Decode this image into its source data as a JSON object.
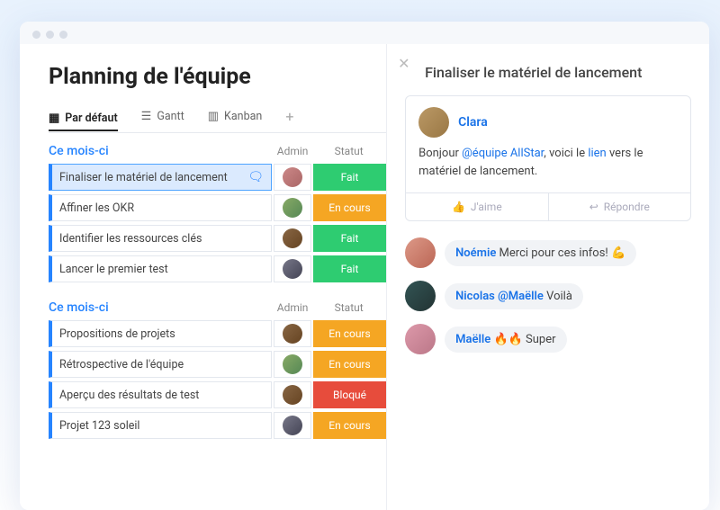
{
  "title": "Planning de l'équipe",
  "tabs": {
    "default": "Par défaut",
    "gantt": "Gantt",
    "kanban": "Kanban"
  },
  "cols": {
    "admin": "Admin",
    "status": "Statut"
  },
  "status_labels": {
    "done": "Fait",
    "prog": "En cours",
    "block": "Bloqué"
  },
  "groups": [
    {
      "title": "Ce mois-ci",
      "rows": [
        {
          "task": "Finaliser le matériel de lancement",
          "status": "done",
          "selected": true,
          "av": "av1"
        },
        {
          "task": "Affiner les OKR",
          "status": "prog",
          "av": "av2"
        },
        {
          "task": "Identifier les ressources clés",
          "status": "done",
          "av": "av3"
        },
        {
          "task": "Lancer le premier test",
          "status": "done",
          "av": "av4"
        }
      ]
    },
    {
      "title": "Ce mois-ci",
      "rows": [
        {
          "task": "Propositions de projets",
          "status": "prog",
          "av": "av3"
        },
        {
          "task": "Rétrospective de l'équipe",
          "status": "prog",
          "av": "av2"
        },
        {
          "task": "Aperçu des résultats de test",
          "status": "block",
          "av": "av3"
        },
        {
          "task": "Projet 123 soleil",
          "status": "prog",
          "av": "av4"
        }
      ]
    }
  ],
  "panel": {
    "title": "Finaliser le matériel de lancement",
    "author": "Clara",
    "msg_pre": "Bonjour ",
    "msg_mention": "@équipe AllStar",
    "msg_mid": ", voici le ",
    "msg_link": "lien",
    "msg_post": " vers le matériel de lancement.",
    "like": "J'aime",
    "reply": "Répondre",
    "comments": [
      {
        "name": "Noémie",
        "text": " Merci pour ces infos! 💪",
        "av": "av5"
      },
      {
        "name": "Nicolas",
        "mention": " @Maëlle",
        "text": " Voilà",
        "av": "av6"
      },
      {
        "name": "Maëlle",
        "text": " 🔥🔥 Super",
        "av": "av7"
      }
    ]
  }
}
